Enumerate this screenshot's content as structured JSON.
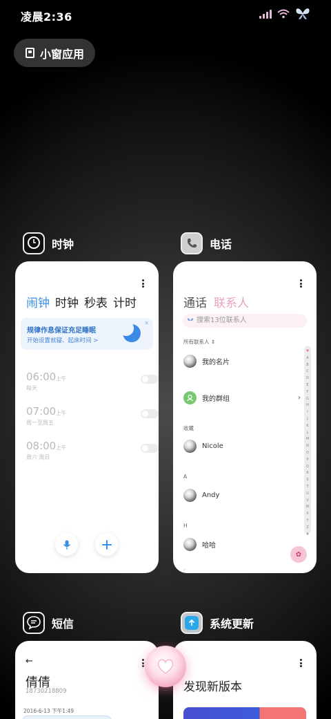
{
  "status": {
    "time": "凌晨2:36"
  },
  "mini_window": {
    "label": "小窗应用"
  },
  "apps": {
    "clock": {
      "name": "时钟",
      "tabs": [
        "闹钟",
        "时钟",
        "秒表",
        "计时"
      ],
      "banner": {
        "title": "规律作息保证充足睡眠",
        "subtitle": "开始设置就寝、起床时间 >"
      },
      "alarms": [
        {
          "time": "06:00",
          "period": "上午",
          "repeat": "每天"
        },
        {
          "time": "07:00",
          "period": "上午",
          "repeat": "周一至周五"
        },
        {
          "time": "08:00",
          "period": "上午",
          "repeat": "周六 周日"
        }
      ]
    },
    "phone": {
      "name": "电话",
      "tabs": [
        "通话",
        "联系人"
      ],
      "search_placeholder": "搜索13位联系人",
      "all_contacts": "所有联系人",
      "my_card": "我的名片",
      "my_groups": "我的群组",
      "section_fav": "收藏",
      "fav_contact": "Nicole",
      "section_a": "A",
      "contact_a": "Andy",
      "section_h": "H",
      "contact_h": "哈哈",
      "index_letters": [
        "♥",
        "A",
        "B",
        "C",
        "D",
        "E",
        "F",
        "G",
        "H",
        "I",
        "J",
        "K",
        "L",
        "M",
        "N",
        "O",
        "P",
        "Q",
        "R",
        "S",
        "T",
        "U",
        "V",
        "W",
        "X",
        "Y",
        "Z",
        "#"
      ]
    },
    "sms": {
      "name": "短信",
      "contact_name": "倩倩",
      "contact_number": "18730218809",
      "date": "2016-6-13 下午1:49"
    },
    "update": {
      "name": "系统更新",
      "title": "发现新版本"
    }
  },
  "colors": {
    "accent": "#3a8ee6",
    "pink": "#e9a2c2",
    "signal": "#e7b7d9"
  }
}
